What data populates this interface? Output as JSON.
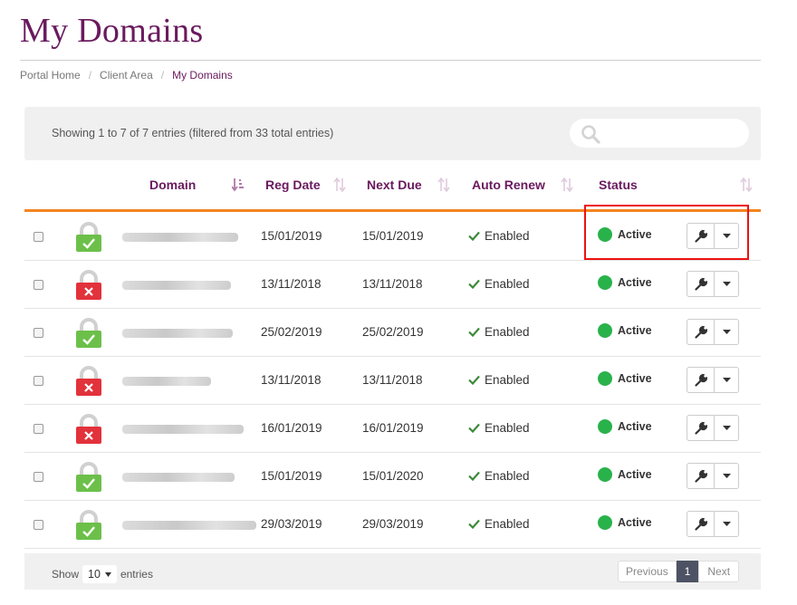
{
  "page": {
    "title": "My Domains"
  },
  "breadcrumb": [
    "Portal Home",
    "Client Area",
    "My Domains"
  ],
  "table_info": "Showing 1 to 7 of 7 entries (filtered from 33 total entries)",
  "search": {
    "placeholder": ""
  },
  "columns": [
    "Domain",
    "Reg Date",
    "Next Due",
    "Auto Renew",
    "Status"
  ],
  "rows": [
    {
      "ssl": "valid",
      "reg_date": "15/01/2019",
      "next_due": "15/01/2019",
      "auto_renew": "Enabled",
      "status": "Active"
    },
    {
      "ssl": "invalid",
      "reg_date": "13/11/2018",
      "next_due": "13/11/2018",
      "auto_renew": "Enabled",
      "status": "Active"
    },
    {
      "ssl": "valid",
      "reg_date": "25/02/2019",
      "next_due": "25/02/2019",
      "auto_renew": "Enabled",
      "status": "Active"
    },
    {
      "ssl": "invalid",
      "reg_date": "13/11/2018",
      "next_due": "13/11/2018",
      "auto_renew": "Enabled",
      "status": "Active"
    },
    {
      "ssl": "invalid",
      "reg_date": "16/01/2019",
      "next_due": "16/01/2019",
      "auto_renew": "Enabled",
      "status": "Active"
    },
    {
      "ssl": "valid",
      "reg_date": "15/01/2019",
      "next_due": "15/01/2020",
      "auto_renew": "Enabled",
      "status": "Active"
    },
    {
      "ssl": "valid",
      "reg_date": "29/03/2019",
      "next_due": "29/03/2019",
      "auto_renew": "Enabled",
      "status": "Active"
    }
  ],
  "footer": {
    "show_label": "Show",
    "length_value": "10",
    "entries_label": "entries"
  },
  "pagination": {
    "previous": "Previous",
    "current": "1",
    "next": "Next"
  },
  "colors": {
    "brand": "#6a1a5e",
    "accent": "#f4841f",
    "status_active": "#29b24a",
    "ssl_valid": "#6cc04a",
    "ssl_invalid": "#e2323b"
  }
}
